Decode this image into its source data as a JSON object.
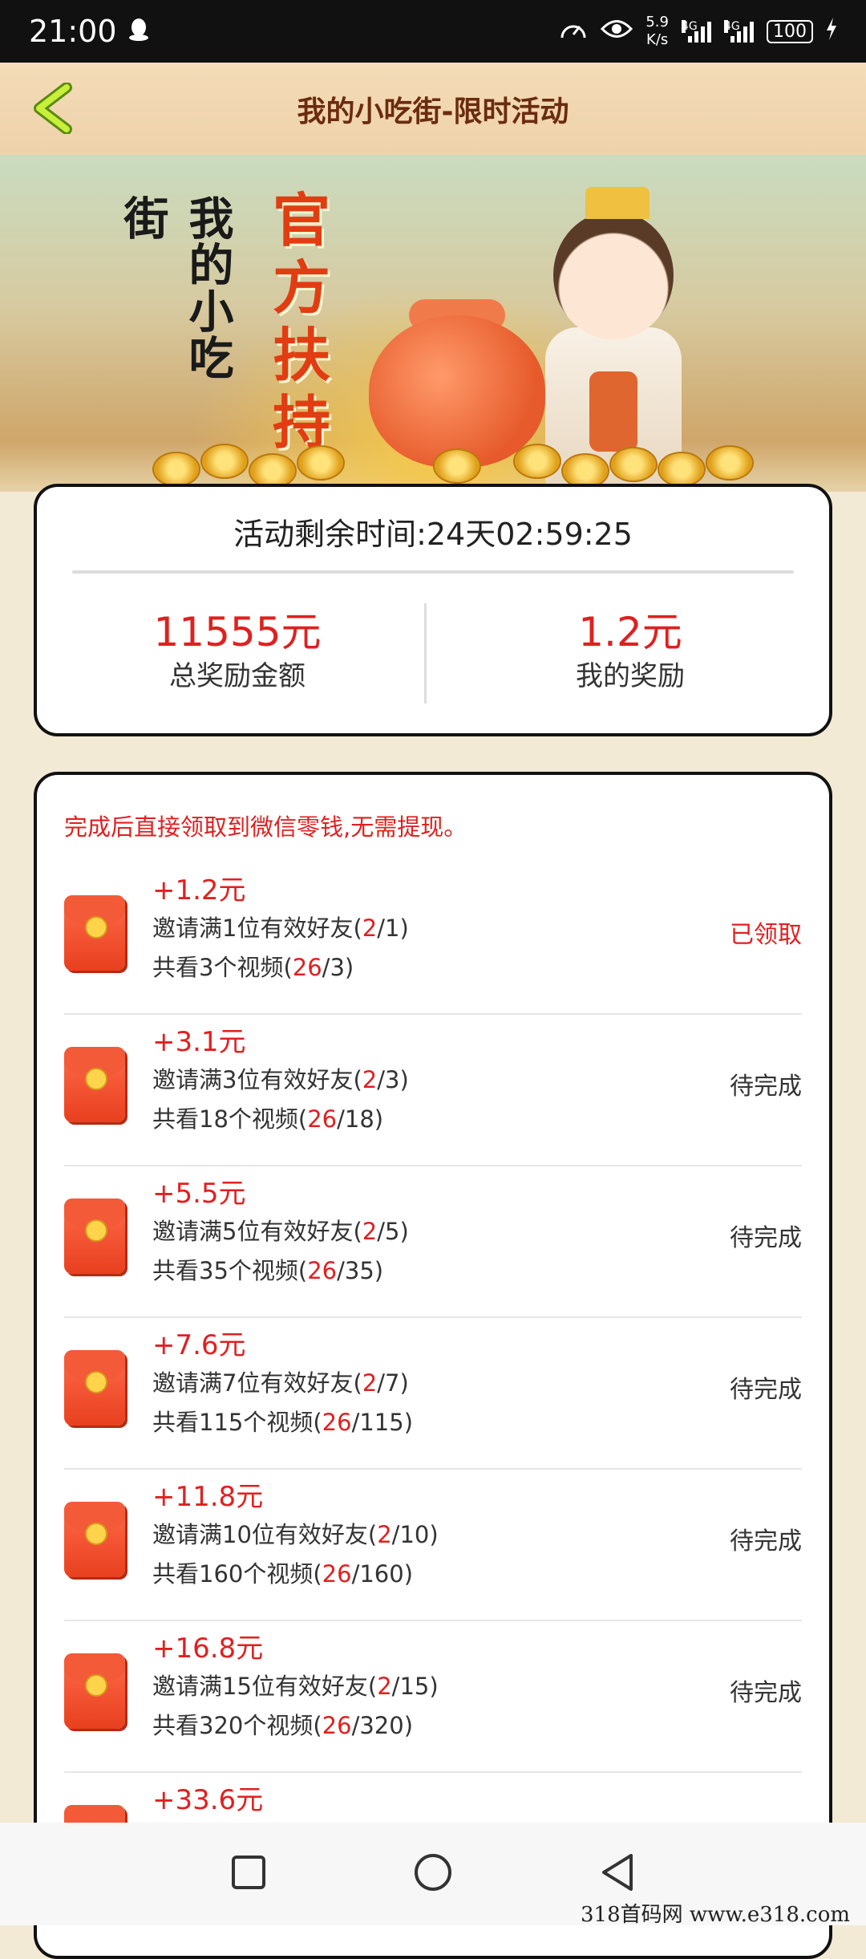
{
  "status_bar": {
    "time": "21:00",
    "speed_value": "5.9",
    "speed_unit": "K/s",
    "network1": "4G",
    "network2": "4G",
    "battery": "100"
  },
  "header": {
    "title": "我的小吃街-限时活动"
  },
  "banner": {
    "logo_text": "我的小吃街",
    "official_text": "官方扶持"
  },
  "timer": {
    "text": "活动剩余时间:24天02:59:25"
  },
  "stats": {
    "total_value": "11555元",
    "total_label": "总奖励金额",
    "mine_value": "1.2元",
    "mine_label": "我的奖励"
  },
  "note": "完成后直接领取到微信零钱,无需提现。",
  "tasks": [
    {
      "reward": "+1.2元",
      "invite_pre": "邀请满1位有效好友(",
      "invite_cur": "2",
      "invite_post": "/1)",
      "video_pre": "共看3个视频(",
      "video_cur": "26",
      "video_post": "/3)",
      "status": "已领取"
    },
    {
      "reward": "+3.1元",
      "invite_pre": "邀请满3位有效好友(",
      "invite_cur": "2",
      "invite_post": "/3)",
      "video_pre": "共看18个视频(",
      "video_cur": "26",
      "video_post": "/18)",
      "status": "待完成"
    },
    {
      "reward": "+5.5元",
      "invite_pre": "邀请满5位有效好友(",
      "invite_cur": "2",
      "invite_post": "/5)",
      "video_pre": "共看35个视频(",
      "video_cur": "26",
      "video_post": "/35)",
      "status": "待完成"
    },
    {
      "reward": "+7.6元",
      "invite_pre": "邀请满7位有效好友(",
      "invite_cur": "2",
      "invite_post": "/7)",
      "video_pre": "共看115个视频(",
      "video_cur": "26",
      "video_post": "/115)",
      "status": "待完成"
    },
    {
      "reward": "+11.8元",
      "invite_pre": "邀请满10位有效好友(",
      "invite_cur": "2",
      "invite_post": "/10)",
      "video_pre": "共看160个视频(",
      "video_cur": "26",
      "video_post": "/160)",
      "status": "待完成"
    },
    {
      "reward": "+16.8元",
      "invite_pre": "邀请满15位有效好友(",
      "invite_cur": "2",
      "invite_post": "/15)",
      "video_pre": "共看320个视频(",
      "video_cur": "26",
      "video_post": "/320)",
      "status": "待完成"
    },
    {
      "reward": "+33.6元",
      "invite_pre": "",
      "invite_cur": "",
      "invite_post": "",
      "video_pre": "",
      "video_cur": "",
      "video_post": "",
      "status": ""
    }
  ],
  "watermark": "318首码网  www.e318.com",
  "colors": {
    "accent_red": "#e02020",
    "header_bg": "#f4dcb8",
    "page_bg": "#f3ead6"
  }
}
